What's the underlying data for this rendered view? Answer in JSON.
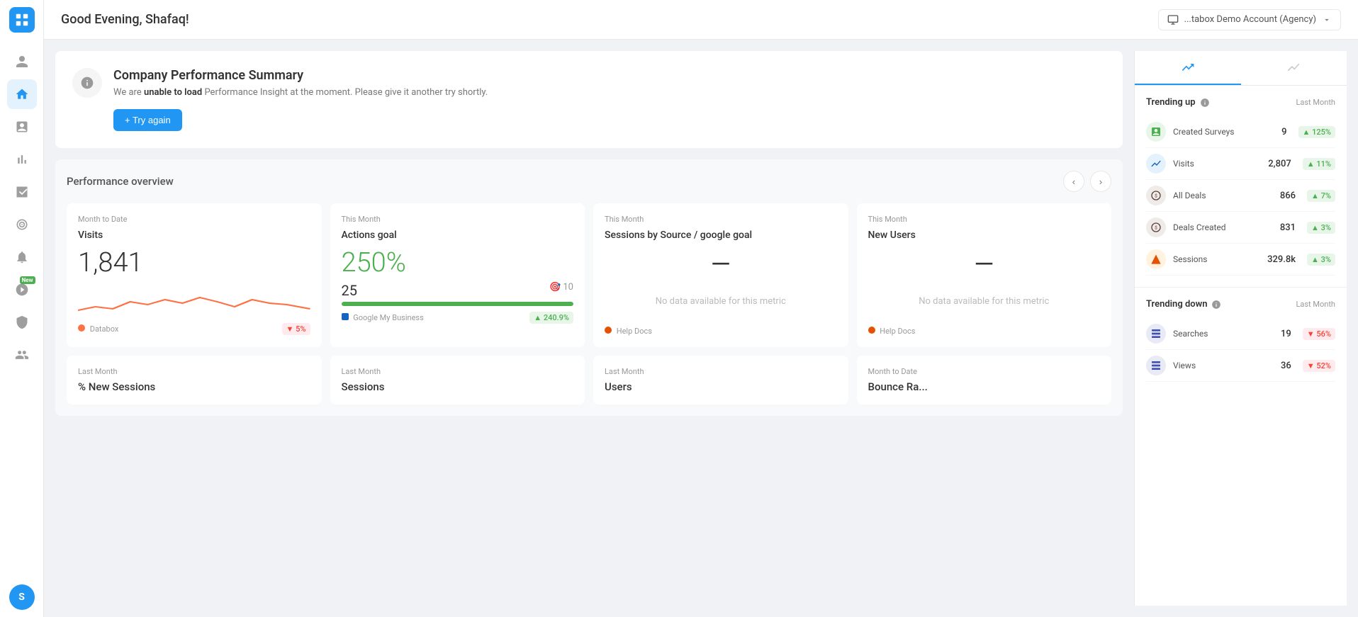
{
  "header": {
    "greeting": "Good Evening, Shafaq!",
    "account": "...tabox Demo Account (Agency)"
  },
  "sidebar": {
    "logo_label": "Databox",
    "avatar_letter": "S",
    "items": [
      {
        "id": "people",
        "label": "People",
        "active": false
      },
      {
        "id": "home",
        "label": "Home",
        "active": true
      },
      {
        "id": "reports",
        "label": "Reports",
        "active": false
      },
      {
        "id": "metrics",
        "label": "Metrics",
        "active": false
      },
      {
        "id": "media",
        "label": "Media",
        "active": false
      },
      {
        "id": "goals",
        "label": "Goals",
        "active": false
      },
      {
        "id": "alerts",
        "label": "Alerts",
        "active": false
      },
      {
        "id": "new-feature",
        "label": "New Feature",
        "active": false,
        "badge": "New"
      },
      {
        "id": "settings",
        "label": "Settings",
        "active": false
      },
      {
        "id": "team",
        "label": "Team",
        "active": false
      }
    ]
  },
  "summary": {
    "title": "Company Performance Summary",
    "description_pre": "We are",
    "description_bold": "unable to load",
    "description_post": "Performance Insight at the moment. Please give it another try shortly.",
    "button_label": "+ Try again"
  },
  "performance_overview": {
    "title": "Performance overview",
    "cards": [
      {
        "period": "Month to Date",
        "title": "Visits",
        "value": "1,841",
        "source": "Databox",
        "source_color": "#FF7043",
        "badge": "▼ 5%",
        "badge_type": "red",
        "has_chart": true
      },
      {
        "period": "This Month",
        "title": "Actions goal",
        "value": "250%",
        "value_color": "green",
        "current": "25",
        "target_icon": "🎯",
        "target": "10",
        "progress": 100,
        "source": "Google My Business",
        "source_color": "#1565C0",
        "badge": "▲ 240.9%",
        "badge_type": "green"
      },
      {
        "period": "This Month",
        "title": "Sessions by Source / google goal",
        "value": "—",
        "no_data": "No data available for this metric",
        "source": "Help Docs",
        "source_color": "#E65100"
      },
      {
        "period": "This Month",
        "title": "New Users",
        "value": "—",
        "no_data": "No data available for this metric",
        "source": "Help Docs",
        "source_color": "#E65100"
      }
    ],
    "bottom_cards": [
      {
        "period": "Last Month",
        "title": "% New Sessions"
      },
      {
        "period": "Last Month",
        "title": "Sessions"
      },
      {
        "period": "Last Month",
        "title": "Users"
      },
      {
        "period": "Month to Date",
        "title": "Bounce Ra..."
      }
    ]
  },
  "right_panel": {
    "tabs": [
      {
        "id": "trending",
        "label": "Trending",
        "active": true
      },
      {
        "id": "activity",
        "label": "Activity",
        "active": false
      }
    ],
    "trending_up": {
      "title": "Trending up",
      "period": "Last Month",
      "items": [
        {
          "name": "Created Surveys",
          "value": "9",
          "badge": "▲ 125%",
          "badge_type": "green",
          "icon_color": "#4CAF50",
          "icon_char": "📊"
        },
        {
          "name": "Visits",
          "value": "2,807",
          "badge": "▲ 11%",
          "badge_type": "green",
          "icon_color": "#1565C0",
          "icon_char": "📈"
        },
        {
          "name": "All Deals",
          "value": "866",
          "badge": "▲ 7%",
          "badge_type": "green",
          "icon_color": "#5D4037",
          "icon_char": "💼"
        },
        {
          "name": "Deals Created",
          "value": "831",
          "badge": "▲ 3%",
          "badge_type": "green",
          "icon_color": "#5D4037",
          "icon_char": "💼"
        },
        {
          "name": "Sessions",
          "value": "329.8k",
          "badge": "▲ 3%",
          "badge_type": "green",
          "icon_color": "#E65100",
          "icon_char": "🔷"
        }
      ]
    },
    "trending_down": {
      "title": "Trending down",
      "period": "Last Month",
      "items": [
        {
          "name": "Searches",
          "value": "19",
          "badge": "▼ 56%",
          "badge_type": "red",
          "icon_color": "#3F51B5",
          "icon_char": "🔷"
        },
        {
          "name": "Views",
          "value": "36",
          "badge": "▼ 52%",
          "badge_type": "red",
          "icon_color": "#3F51B5",
          "icon_char": "🔷"
        }
      ]
    }
  }
}
